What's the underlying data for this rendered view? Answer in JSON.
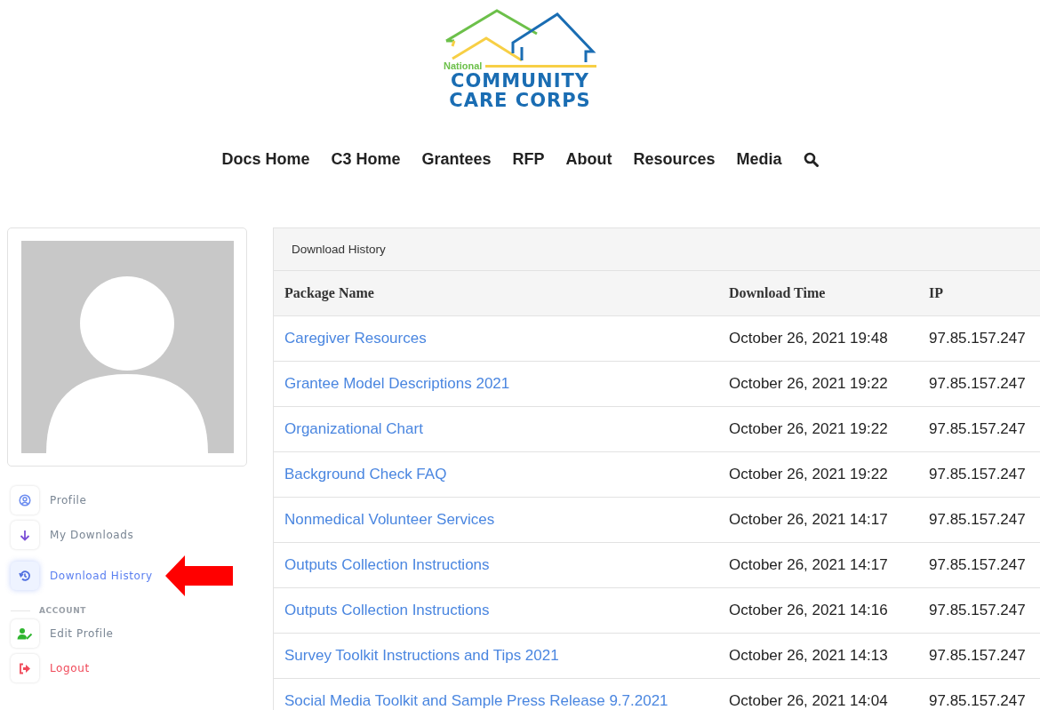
{
  "logo": {
    "small": "National",
    "line1": "COMMUNITY",
    "line2": "CARE CORPS"
  },
  "nav": [
    "Docs Home",
    "C3 Home",
    "Grantees",
    "RFP",
    "About",
    "Resources",
    "Media"
  ],
  "sidebar": {
    "items": [
      {
        "label": "Profile",
        "kind": "profile",
        "selected": false,
        "color": "#6b8cf0"
      },
      {
        "label": "My Downloads",
        "kind": "download",
        "selected": false,
        "color": "#7b4fd6"
      },
      {
        "label": "Download History",
        "kind": "history",
        "selected": true,
        "color": "#4f6fe0"
      }
    ],
    "section": "ACCOUNT",
    "account_items": [
      {
        "label": "Edit Profile",
        "kind": "edit",
        "color": "#2fb52f"
      },
      {
        "label": "Logout",
        "kind": "logout",
        "color": "#f04a5a"
      }
    ]
  },
  "panel": {
    "title": "Download History",
    "columns": [
      "Package Name",
      "Download Time",
      "IP"
    ],
    "rows": [
      [
        "Caregiver Resources",
        "October 26, 2021 19:48",
        "97.85.157.247"
      ],
      [
        "Grantee Model Descriptions 2021",
        "October 26, 2021 19:22",
        "97.85.157.247"
      ],
      [
        "Organizational Chart",
        "October 26, 2021 19:22",
        "97.85.157.247"
      ],
      [
        "Background Check FAQ",
        "October 26, 2021 19:22",
        "97.85.157.247"
      ],
      [
        "Nonmedical Volunteer Services",
        "October 26, 2021 14:17",
        "97.85.157.247"
      ],
      [
        "Outputs Collection Instructions",
        "October 26, 2021 14:17",
        "97.85.157.247"
      ],
      [
        "Outputs Collection Instructions",
        "October 26, 2021 14:16",
        "97.85.157.247"
      ],
      [
        "Survey Toolkit Instructions and Tips 2021",
        "October 26, 2021 14:13",
        "97.85.157.247"
      ],
      [
        "Social Media Toolkit and Sample Press Release 9.7.2021",
        "October 26, 2021 14:04",
        "97.85.157.247"
      ]
    ]
  }
}
